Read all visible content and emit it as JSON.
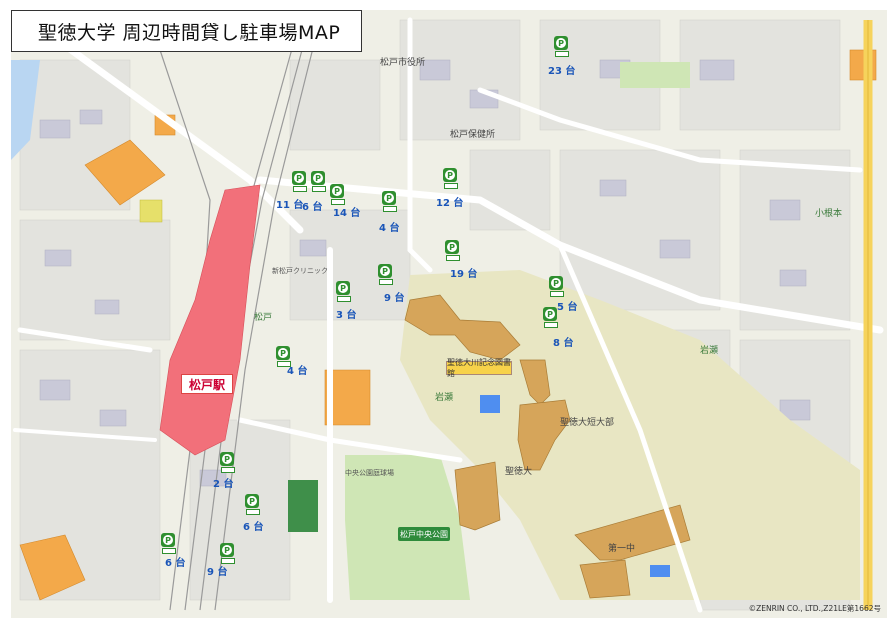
{
  "title": "聖徳大学 周辺時間貸し駐車場MAP",
  "station": "松戸駅",
  "copyright": "©ZENRIN CO., LTD.,Z21LE第1662号",
  "landmarks": {
    "city_hall": "松戸市役所",
    "health_center": "松戸保健所",
    "library": "聖徳大川記念図書館",
    "park": "松戸中央公園",
    "park_field": "中央公園庭球場",
    "univ_junior": "聖徳大短大部",
    "univ": "聖徳大",
    "school": "第一中",
    "area_iwase": "岩瀬",
    "area_koneki": "小根本",
    "area_matsudo": "松戸",
    "fire": "第一中",
    "clinic": "新松戸クリニック"
  },
  "parkings": [
    {
      "id": "p23",
      "count": "23 台"
    },
    {
      "id": "p11",
      "count": "11 台"
    },
    {
      "id": "p6a",
      "count": "6 台"
    },
    {
      "id": "p14",
      "count": "14 台"
    },
    {
      "id": "p4a",
      "count": "4 台"
    },
    {
      "id": "p12",
      "count": "12 台"
    },
    {
      "id": "p19",
      "count": "19 台"
    },
    {
      "id": "p9a",
      "count": "9 台"
    },
    {
      "id": "p3",
      "count": "3 台"
    },
    {
      "id": "p5",
      "count": "5 台"
    },
    {
      "id": "p8",
      "count": "8 台"
    },
    {
      "id": "p4b",
      "count": "4 台"
    },
    {
      "id": "p2",
      "count": "2 台"
    },
    {
      "id": "p6b",
      "count": "6 台"
    },
    {
      "id": "p6c",
      "count": "6 台"
    },
    {
      "id": "p9b",
      "count": "9 台"
    }
  ],
  "colors": {
    "parking": "#2f8f2f",
    "count": "#1a55b8",
    "station": "#f2707a",
    "building": "#d6a55a"
  }
}
